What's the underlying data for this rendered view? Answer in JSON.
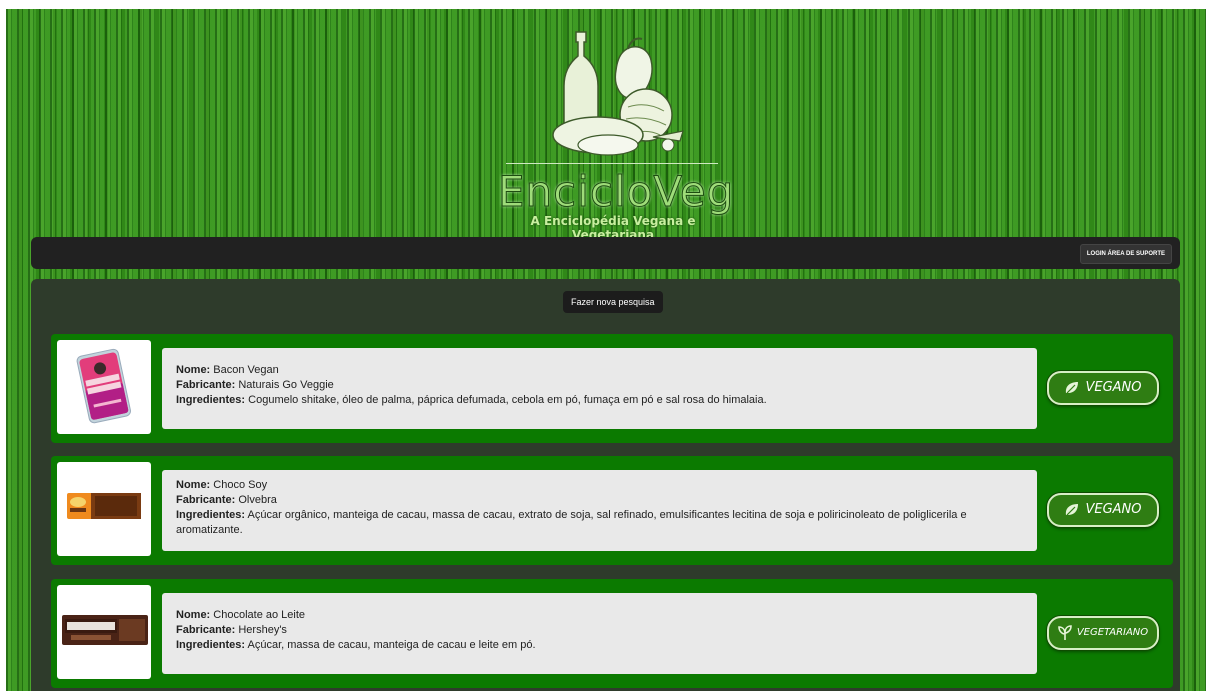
{
  "header": {
    "logo_title": "EncicloVeg",
    "logo_subtitle": "A Enciclopédia Vegana e Vegetariana"
  },
  "navbar": {
    "support_login_label": "LOGIN ÁREA DE SUPORTE"
  },
  "main": {
    "new_search_label": "Fazer nova pesquisa",
    "labels": {
      "name": "Nome:",
      "manufacturer": "Fabricante:",
      "ingredients": "Ingredientes:"
    },
    "products": [
      {
        "name": "Bacon Vegan",
        "manufacturer": "Naturais Go Veggie",
        "ingredients": "Cogumelo shitake, óleo de palma, páprica defumada, cebola em pó, fumaça em pó e sal rosa do himalaia.",
        "category": "VEGANO",
        "category_icon": "leaf-icon",
        "image_name": "bacon-vegan-package"
      },
      {
        "name": "Choco Soy",
        "manufacturer": "Olvebra",
        "ingredients": "Açúcar orgânico, manteiga de cacau, massa de cacau, extrato de soja, sal refinado, emulsificantes lecitina de soja e poliricinoleato de poliglicerila e aromatizante.",
        "category": "VEGANO",
        "category_icon": "leaf-icon",
        "image_name": "choco-soy-bar"
      },
      {
        "name": "Chocolate ao Leite",
        "manufacturer": "Hershey's",
        "ingredients": "Açúcar, massa de cacau, manteiga de cacau e leite em pó.",
        "category": "VEGETARIANO",
        "category_icon": "sprout-icon",
        "image_name": "hersheys-bar"
      }
    ]
  },
  "colors": {
    "background_green": "#2f8f16",
    "navbar": "#212121",
    "main_panel": "#2e3b2b",
    "product_card": "#0b7a00",
    "info_box": "#e9e9e9",
    "badge": "#2f7d13"
  }
}
